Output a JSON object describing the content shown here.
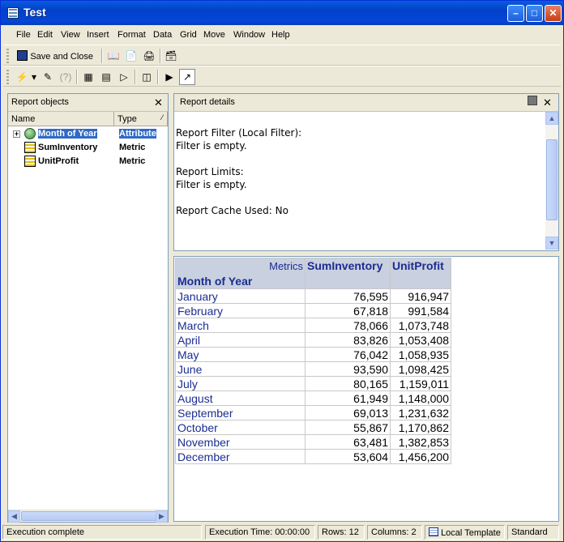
{
  "window": {
    "title": "Test"
  },
  "menu": [
    "File",
    "Edit",
    "View",
    "Insert",
    "Format",
    "Data",
    "Grid",
    "Move",
    "Window",
    "Help"
  ],
  "toolbar": {
    "save_close_label": "Save and Close"
  },
  "report_objects": {
    "title": "Report objects",
    "col_name": "Name",
    "col_type": "Type",
    "items": [
      {
        "name": "Month of Year",
        "type": "Attribute",
        "icon": "attribute-icon"
      },
      {
        "name": "SumInventory",
        "type": "Metric",
        "icon": "metric-icon"
      },
      {
        "name": "UnitProfit",
        "type": "Metric",
        "icon": "metric-icon"
      }
    ]
  },
  "report_details": {
    "title": "Report details",
    "lines": [
      "Report Filter (Local Filter):",
      "Filter is empty.",
      "",
      "Report Limits:",
      "Filter is empty.",
      "",
      "Report Cache Used: No"
    ]
  },
  "grid": {
    "metrics_label": "Metrics",
    "row_header": "Month of Year",
    "columns": [
      "SumInventory",
      "UnitProfit"
    ],
    "rows": [
      {
        "month": "January",
        "sum_inventory": "76,595",
        "unit_profit": "916,947"
      },
      {
        "month": "February",
        "sum_inventory": "67,818",
        "unit_profit": "991,584"
      },
      {
        "month": "March",
        "sum_inventory": "78,066",
        "unit_profit": "1,073,748"
      },
      {
        "month": "April",
        "sum_inventory": "83,826",
        "unit_profit": "1,053,408"
      },
      {
        "month": "May",
        "sum_inventory": "76,042",
        "unit_profit": "1,058,935"
      },
      {
        "month": "June",
        "sum_inventory": "93,590",
        "unit_profit": "1,098,425"
      },
      {
        "month": "July",
        "sum_inventory": "80,165",
        "unit_profit": "1,159,011"
      },
      {
        "month": "August",
        "sum_inventory": "61,949",
        "unit_profit": "1,148,000"
      },
      {
        "month": "September",
        "sum_inventory": "69,013",
        "unit_profit": "1,231,632"
      },
      {
        "month": "October",
        "sum_inventory": "55,867",
        "unit_profit": "1,170,862"
      },
      {
        "month": "November",
        "sum_inventory": "63,481",
        "unit_profit": "1,382,853"
      },
      {
        "month": "December",
        "sum_inventory": "53,604",
        "unit_profit": "1,456,200"
      }
    ]
  },
  "status": {
    "message": "Execution complete",
    "execution_time": "Execution Time: 00:00:00",
    "rows": "Rows: 12",
    "columns": "Columns: 2",
    "template": "Local Template",
    "mode": "Standard"
  },
  "colors": {
    "title_bar": "#0545d8",
    "grid_text": "#1b2d8f",
    "grid_header_bg": "#c9d0e0",
    "selection": "#316ac5"
  }
}
